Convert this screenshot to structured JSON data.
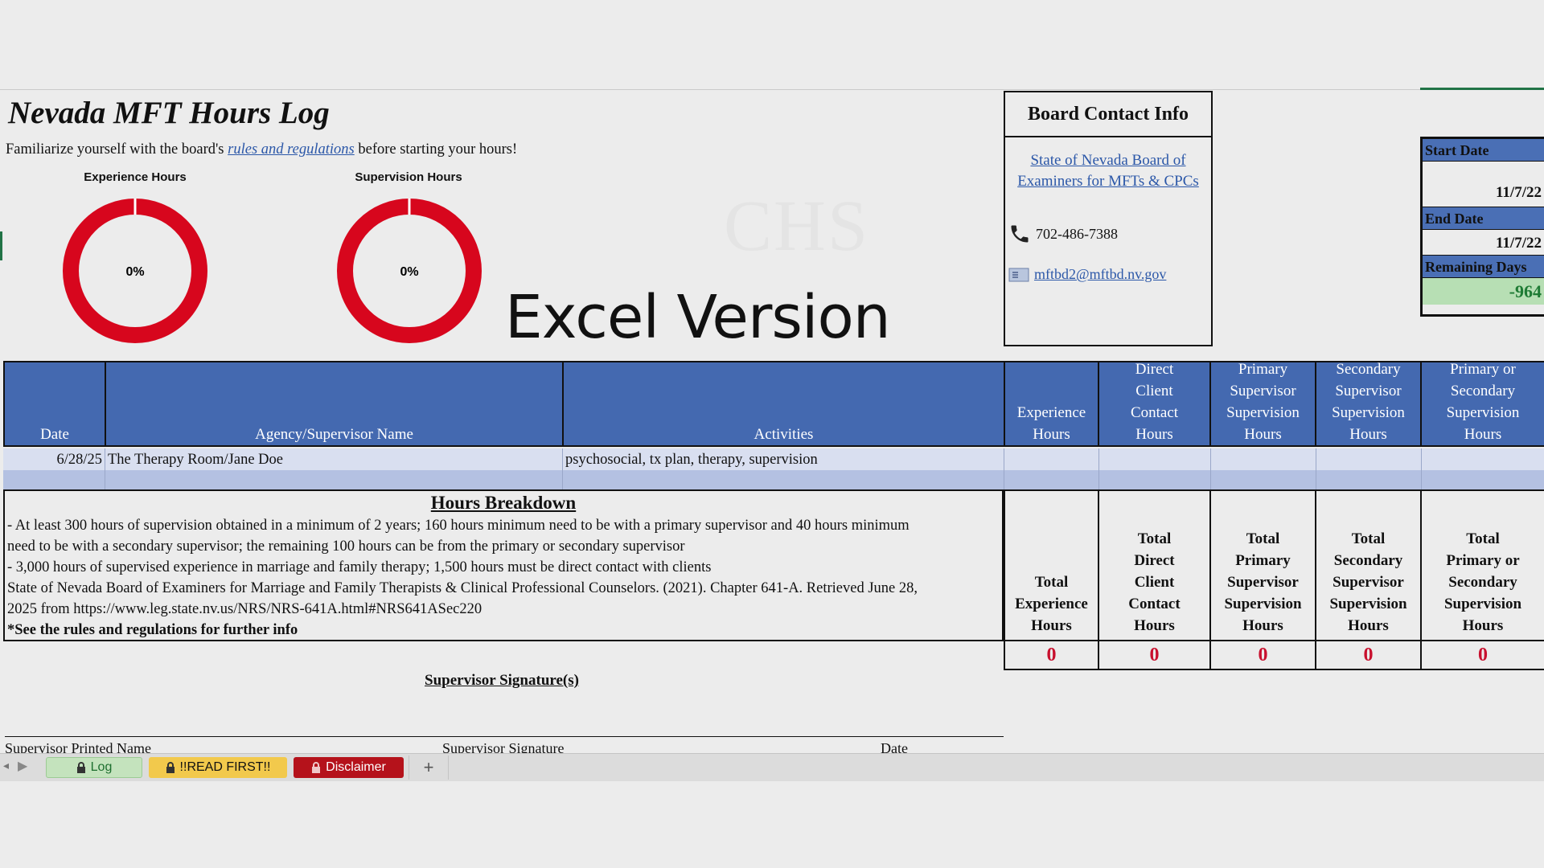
{
  "title": "Nevada MFT Hours Log",
  "intro": {
    "before": "Familiarize yourself with the board's ",
    "link": "rules and regulations",
    "after": " before starting your hours!"
  },
  "charts": {
    "experience": {
      "title": "Experience Hours",
      "label": "0%",
      "fraction": 0
    },
    "supervision": {
      "title": "Supervision Hours",
      "label": "0%",
      "fraction": 0
    },
    "ring_color": "#d7061d"
  },
  "excel_version": "Excel Version",
  "watermark": "CHS",
  "board_contact": {
    "heading": "Board Contact Info",
    "link_line1": "State of Nevada Board of",
    "link_line2": "Examiners for MFTs & CPCs",
    "phone": "702-486-7388",
    "email": "mftbd2@mftbd.nv.gov"
  },
  "dates": {
    "start_label": "Start Date",
    "start_value": "11/7/22",
    "end_label": "End Date",
    "end_value": "11/7/22",
    "remaining_label": "Remaining Days",
    "remaining_value": "-964"
  },
  "table": {
    "headers": {
      "date": "Date",
      "agency": "Agency/Supervisor Name",
      "activities": "Activities",
      "experience": [
        "Experience",
        "Hours"
      ],
      "direct": [
        "Direct",
        "Client",
        "Contact",
        "Hours"
      ],
      "primary": [
        "Primary",
        "Supervisor",
        "Supervision",
        "Hours"
      ],
      "secondary": [
        "Secondary",
        "Supervisor",
        "Supervision",
        "Hours"
      ],
      "either": [
        "Primary or",
        "Secondary",
        "Supervision",
        "Hours"
      ]
    },
    "rows": [
      {
        "date": "6/28/25",
        "agency": "The Therapy Room/Jane Doe",
        "activities": "psychosocial, tx plan, therapy, supervision"
      }
    ]
  },
  "breakdown": {
    "title": "Hours Breakdown",
    "line1": "- At least 300 hours of supervision obtained in a minimum of 2 years; 160 hours minimum need to be with a primary supervisor and 40 hours minimum",
    "line2": "need to be with a secondary supervisor; the remaining 100 hours can be from the primary or secondary supervisor",
    "line3": "- 3,000 hours of supervised experience in marriage and family therapy; 1,500 hours must be direct contact with clients",
    "line4": "State of Nevada Board of Examiners for Marriage and Family Therapists & Clinical Professional Counselors. (2021). Chapter 641-A. Retrieved June 28,",
    "line5": "2025 from https://www.leg.state.nv.us/NRS/NRS-641A.html#NRS641ASec220",
    "line6": "*See the rules and regulations for further info"
  },
  "totals": {
    "experience": {
      "label": [
        "Total",
        "Experience",
        "Hours"
      ],
      "value": "0"
    },
    "direct": {
      "label": [
        "Total",
        "Direct",
        "Client",
        "Contact",
        "Hours"
      ],
      "value": "0"
    },
    "primary": {
      "label": [
        "Total",
        "Primary",
        "Supervisor",
        "Supervision",
        "Hours"
      ],
      "value": "0"
    },
    "secondary": {
      "label": [
        "Total",
        "Secondary",
        "Supervisor",
        "Supervision",
        "Hours"
      ],
      "value": "0"
    },
    "either": {
      "label": [
        "Total",
        "Primary or",
        "Secondary",
        "Supervision",
        "Hours"
      ],
      "value": "0"
    }
  },
  "signature": {
    "title": "Supervisor Signature(s)",
    "printed_name": "Supervisor Printed Name",
    "signature": "Supervisor Signature",
    "date": "Date"
  },
  "tabs": {
    "log": "Log",
    "read_first": "!!READ FIRST!!",
    "disclaimer": "Disclaimer",
    "add": "+"
  },
  "colors": {
    "header_blue": "#4469b0",
    "date_label_blue": "#4a6fb5",
    "remaining_green": "#b7dfb4",
    "remaining_text": "#1e7b34",
    "total_red": "#c8102e",
    "tab_log": "#c4e3bd",
    "tab_read_first": "#f2c94c",
    "tab_disclaimer": "#b5121b"
  }
}
